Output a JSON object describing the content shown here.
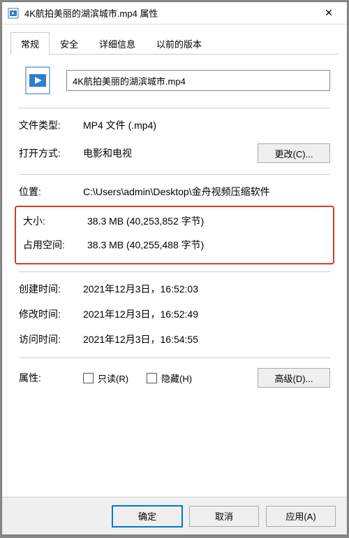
{
  "window": {
    "title": "4K航拍美丽的湖滨城市.mp4 属性",
    "close": "✕"
  },
  "tabs": {
    "general": "常规",
    "security": "安全",
    "details": "详细信息",
    "previous": "以前的版本"
  },
  "file": {
    "name": "4K航拍美丽的湖滨城市.mp4"
  },
  "rows": {
    "type_label": "文件类型:",
    "type_value": "MP4 文件 (.mp4)",
    "open_with_label": "打开方式:",
    "open_with_value": "电影和电视",
    "change_btn": "更改(C)...",
    "location_label": "位置:",
    "location_value": "C:\\Users\\admin\\Desktop\\金舟视频压缩软件",
    "size_label": "大小:",
    "size_value": "38.3 MB (40,253,852 字节)",
    "size_on_disk_label": "占用空间:",
    "size_on_disk_value": "38.3 MB (40,255,488 字节)",
    "created_label": "创建时间:",
    "created_value": "2021年12月3日，16:52:03",
    "modified_label": "修改时间:",
    "modified_value": "2021年12月3日，16:52:49",
    "accessed_label": "访问时间:",
    "accessed_value": "2021年12月3日，16:54:55",
    "attr_label": "属性:",
    "readonly_label": "只读(R)",
    "hidden_label": "隐藏(H)",
    "advanced_btn": "高级(D)..."
  },
  "footer": {
    "ok": "确定",
    "cancel": "取消",
    "apply": "应用(A)"
  }
}
